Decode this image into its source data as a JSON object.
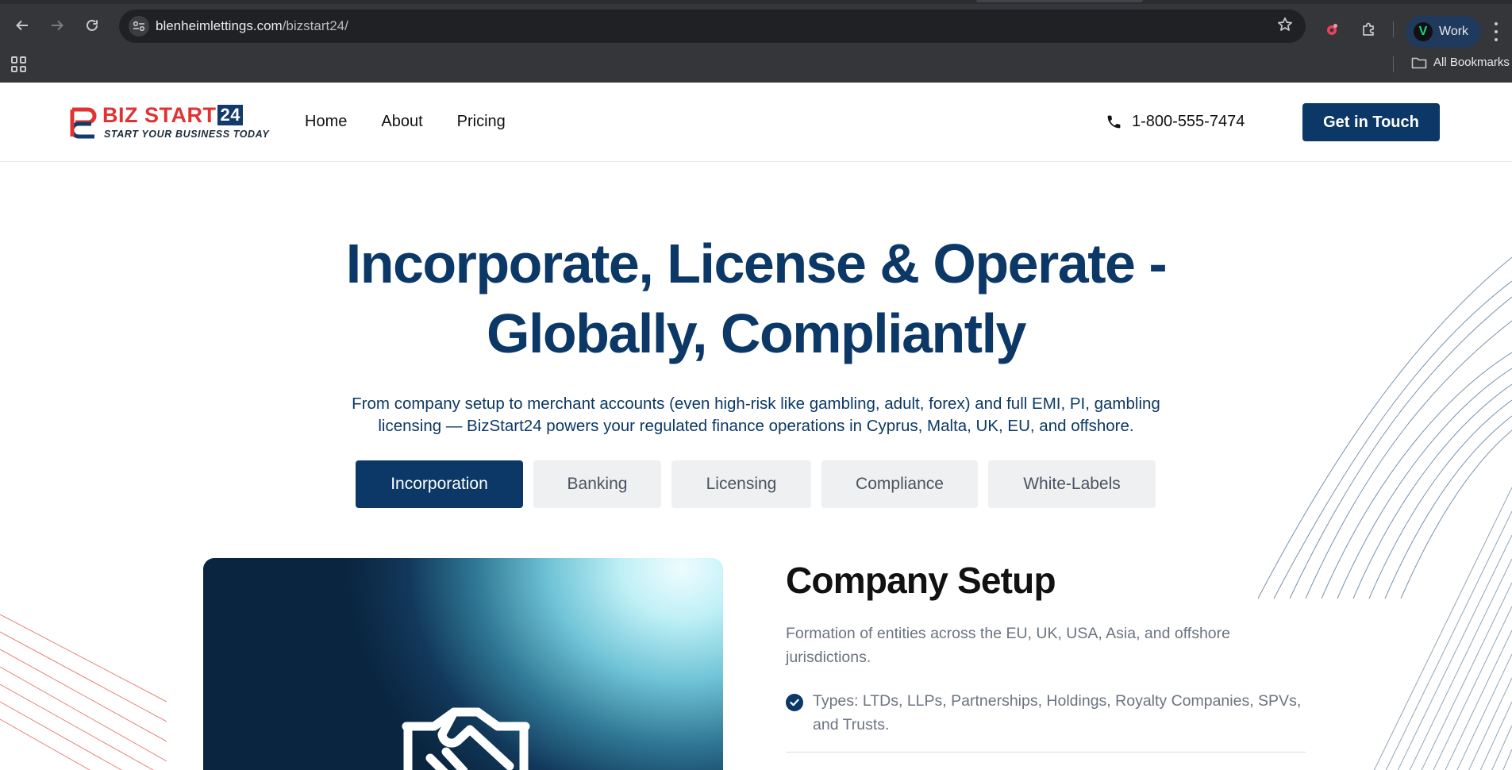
{
  "browser": {
    "url_host": "blenheimlettings.com",
    "url_path": "/bizstart24/",
    "profile_name": "Work",
    "profile_initial": "V",
    "bookmarks_label": "All Bookmarks",
    "icons": [
      "back-arrow-icon",
      "forward-arrow-icon",
      "reload-icon",
      "site-settings-icon",
      "star-icon",
      "extension-icon",
      "puzzle-icon",
      "apps-grid-icon",
      "folder-icon",
      "kebab-menu-icon"
    ]
  },
  "site": {
    "logo": {
      "word": "BIZ START",
      "number": "24",
      "tagline": "START YOUR BUSINESS TODAY"
    },
    "nav": [
      {
        "label": "Home"
      },
      {
        "label": "About"
      },
      {
        "label": "Pricing"
      }
    ],
    "phone": "1-800-555-7474",
    "cta_label": "Get in Touch",
    "hero": {
      "title_line1": "Incorporate, License & Operate -",
      "title_line2": "Globally, Compliantly",
      "subtitle_line1": "From company setup to merchant accounts (even high-risk like gambling, adult, forex) and full EMI, PI, gambling",
      "subtitle_line2": "licensing — BizStart24 powers your regulated finance operations in Cyprus, Malta, UK, EU, and offshore."
    },
    "tabs": [
      {
        "label": "Incorporation",
        "active": true
      },
      {
        "label": "Banking",
        "active": false
      },
      {
        "label": "Licensing",
        "active": false
      },
      {
        "label": "Compliance",
        "active": false
      },
      {
        "label": "White-Labels",
        "active": false
      }
    ],
    "panel": {
      "title": "Company Setup",
      "description": "Formation of entities across the EU, UK, USA, Asia, and offshore jurisdictions.",
      "bullets": [
        "Types: LTDs, LLPs, Partnerships, Holdings, Royalty Companies, SPVs, and Trusts."
      ],
      "image_icon": "handshake-icon"
    },
    "colors": {
      "brand_navy": "#0b3866",
      "brand_red": "#e03232",
      "tab_inactive_bg": "#eef0f2",
      "muted_text": "#6b7480"
    }
  }
}
